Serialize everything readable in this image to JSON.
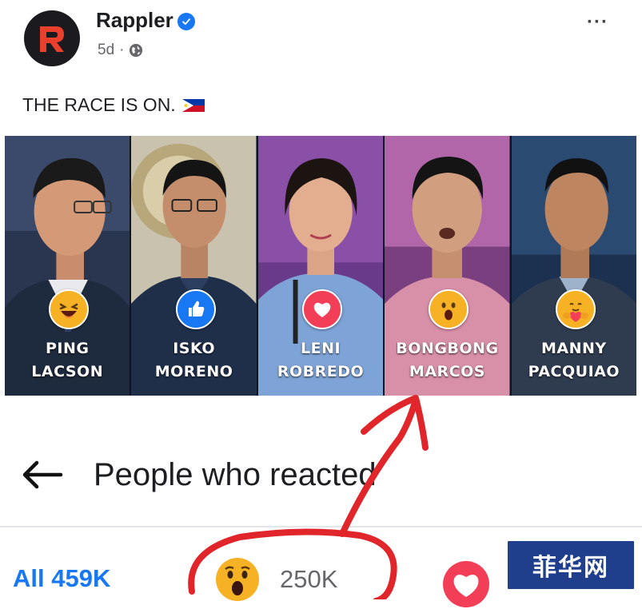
{
  "post": {
    "page_name": "Rappler",
    "time": "5d",
    "separator": "·",
    "caption": "THE RACE IS ON.",
    "more_label": "···"
  },
  "candidates": [
    {
      "first": "PING",
      "last": "LACSON",
      "reaction": "haha-icon",
      "color": "#f7b125"
    },
    {
      "first": "ISKO",
      "last": "MORENO",
      "reaction": "like-icon",
      "color": "#1877f2"
    },
    {
      "first": "LENI",
      "last": "ROBREDO",
      "reaction": "heart-icon",
      "color": "#f33e58"
    },
    {
      "first": "BONGBONG",
      "last": "MARCOS",
      "reaction": "wow-icon",
      "color": "#f7b125"
    },
    {
      "first": "MANNY",
      "last": "PACQUIAO",
      "reaction": "care-icon",
      "color": "#f7b125"
    }
  ],
  "reactions_panel": {
    "title": "People who reacted",
    "tab_all": "All 459K",
    "tab_wow_count": "250K"
  },
  "watermark": {
    "text": "菲华网"
  },
  "colors": {
    "accent": "#1877f2",
    "annotation": "#e0262b"
  }
}
